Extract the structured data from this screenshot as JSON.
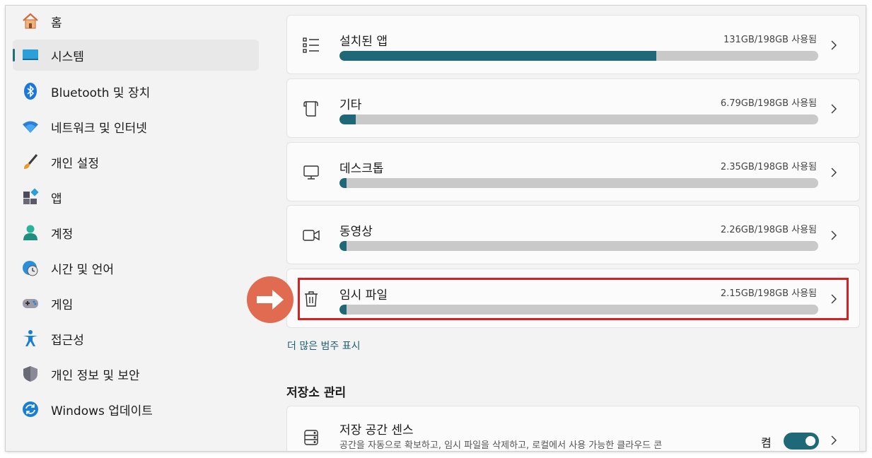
{
  "sidebar": {
    "items": [
      {
        "label": "홈",
        "icon": "home-icon"
      },
      {
        "label": "시스템",
        "icon": "system-icon",
        "selected": true
      },
      {
        "label": "Bluetooth 및 장치",
        "icon": "bluetooth-icon"
      },
      {
        "label": "네트워크 및 인터넷",
        "icon": "wifi-icon"
      },
      {
        "label": "개인 설정",
        "icon": "brush-icon"
      },
      {
        "label": "앱",
        "icon": "apps-icon"
      },
      {
        "label": "계정",
        "icon": "account-icon"
      },
      {
        "label": "시간 및 언어",
        "icon": "clock-globe-icon"
      },
      {
        "label": "게임",
        "icon": "gamepad-icon"
      },
      {
        "label": "접근성",
        "icon": "accessibility-icon"
      },
      {
        "label": "개인 정보 및 보안",
        "icon": "shield-icon"
      },
      {
        "label": "Windows 업데이트",
        "icon": "update-icon"
      }
    ]
  },
  "storage": {
    "categories": [
      {
        "title": "설치된 앱",
        "usage": "131GB/198GB 사용됨",
        "fraction": 0.662,
        "icon": "list-icon"
      },
      {
        "title": "기타",
        "usage": "6.79GB/198GB 사용됨",
        "fraction": 0.034,
        "icon": "document-icon"
      },
      {
        "title": "데스크톱",
        "usage": "2.35GB/198GB 사용됨",
        "fraction": 0.012,
        "icon": "monitor-icon"
      },
      {
        "title": "동영상",
        "usage": "2.26GB/198GB 사용됨",
        "fraction": 0.011,
        "icon": "video-icon"
      },
      {
        "title": "임시 파일",
        "usage": "2.15GB/198GB 사용됨",
        "fraction": 0.011,
        "icon": "trash-icon"
      }
    ],
    "more_link": "더 많은 범주 표시"
  },
  "management": {
    "section_title": "저장소 관리",
    "sense_title": "저장 공간 센스",
    "sense_desc": "공간을 자동으로 확보하고, 임시 파일을 삭제하고, 로컬에서 사용 가능한 클라우드 콘",
    "toggle_label": "켬",
    "toggle_on": true
  },
  "colors": {
    "accent": "#1e6878",
    "highlight_border": "#d92020",
    "arrow_badge": "#e06b50"
  }
}
